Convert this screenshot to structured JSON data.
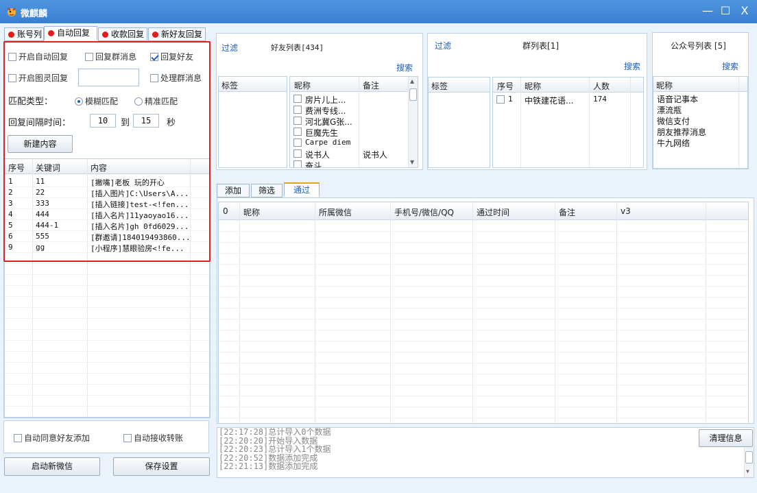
{
  "window": {
    "title": "微麒麟",
    "minimize": "—",
    "maximize": "☐",
    "close": "X"
  },
  "left_tabs": [
    "账号列",
    "自动回复",
    "收款回复",
    "新好友回复"
  ],
  "auto_reply": {
    "open_auto_reply": "开启自动回复",
    "reply_group": "回复群消息",
    "reply_friend": "回复好友",
    "open_tuling": "开启图灵回复",
    "tuling_value": "",
    "handle_group": "处理群消息",
    "match_type_label": "匹配类型：",
    "fuzzy_match": "模糊匹配",
    "exact_match": "精准匹配",
    "interval_label": "回复间隔时间：",
    "interval_from": "10",
    "interval_to_label": "到",
    "interval_to": "15",
    "interval_unit": "秒",
    "new_content_button": "新建内容",
    "columns": [
      "序号",
      "关键词",
      "内容"
    ],
    "rows": [
      [
        "1",
        "11",
        "[撇嘴]老板 玩的开心"
      ],
      [
        "2",
        "22",
        "[插入图片]C:\\Users\\A..."
      ],
      [
        "3",
        "333",
        "[插入链接]test-<!fen..."
      ],
      [
        "4",
        "444",
        "[插入名片]11yaoyao16..."
      ],
      [
        "5",
        "444-1",
        "[插入名片]gh_0fd6029..."
      ],
      [
        "6",
        "555",
        "[群邀请]184019493860..."
      ],
      [
        "9",
        "gg",
        "[小程序]慧眼验房<!fe..."
      ]
    ]
  },
  "bottom_left": {
    "auto_accept_friend": "自动同意好友添加",
    "auto_receive_transfer": "自动接收转账",
    "start_wechat_button": "启动新微信",
    "save_settings_button": "保存设置"
  },
  "friends": {
    "filter_label": "过滤",
    "title": "好友列表[434]",
    "search": "搜索",
    "tag_header": "标签",
    "columns": [
      "昵称",
      "备注"
    ],
    "rows": [
      [
        "房片儿上...",
        ""
      ],
      [
        "费洲专线...",
        ""
      ],
      [
        "河北冀G张...",
        ""
      ],
      [
        "巨魔先生",
        ""
      ],
      [
        "Carpe diem",
        ""
      ],
      [
        "说书人",
        "说书人"
      ],
      [
        "奋斗",
        ""
      ]
    ]
  },
  "groups": {
    "filter_label": "过滤",
    "title": "群列表[1]",
    "search": "搜索",
    "tag_header": "标签",
    "columns": [
      "序号",
      "昵称",
      "人数"
    ],
    "rows": [
      [
        "1",
        "中铁建花语...",
        "174"
      ]
    ]
  },
  "official": {
    "title": "公众号列表 [5]",
    "search": "搜索",
    "column": "昵称",
    "rows": [
      "语音记事本",
      "漂流瓶",
      "微信支付",
      "朋友推荐消息",
      "牛九网络"
    ]
  },
  "right_tabs": [
    "添加",
    "筛选",
    "通过"
  ],
  "pass_table": {
    "columns": [
      "0",
      "昵称",
      "所属微信",
      "手机号/微信/QQ",
      "通过时间",
      "备注",
      "v3"
    ]
  },
  "log": {
    "lines": [
      "[22:17:28]总计导入0个数据",
      "[22:20:20]开始导入数据",
      "[22:20:23]总计导入1个数据",
      "[22:20:52]数据添加完成",
      "[22:21:13]数据添加完成"
    ],
    "clear_button": "清理信息"
  }
}
